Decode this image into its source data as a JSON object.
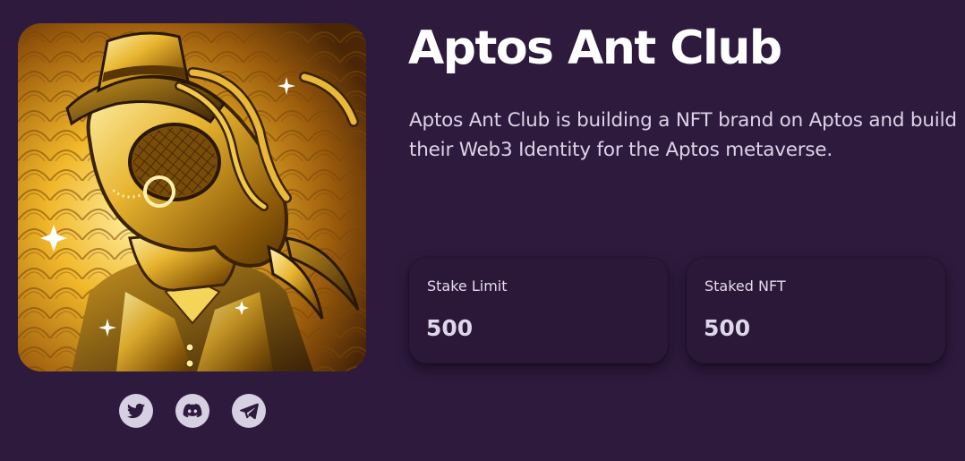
{
  "collection": {
    "name": "Aptos Ant Club",
    "description": "Aptos Ant Club is building a NFT brand on Aptos and build their Web3 Identity for the Aptos metaverse."
  },
  "stats": [
    {
      "label": "Stake Limit",
      "value": "500"
    },
    {
      "label": "Staked NFT",
      "value": "500"
    }
  ],
  "socials": [
    {
      "icon": "twitter-icon"
    },
    {
      "icon": "discord-icon"
    },
    {
      "icon": "telegram-icon"
    }
  ],
  "colors": {
    "background": "#2e1a3d",
    "card": "#2b1738",
    "icon_circle": "#d7cfe2",
    "icon_glyph": "#2e1a3d",
    "title": "#ffffff"
  }
}
